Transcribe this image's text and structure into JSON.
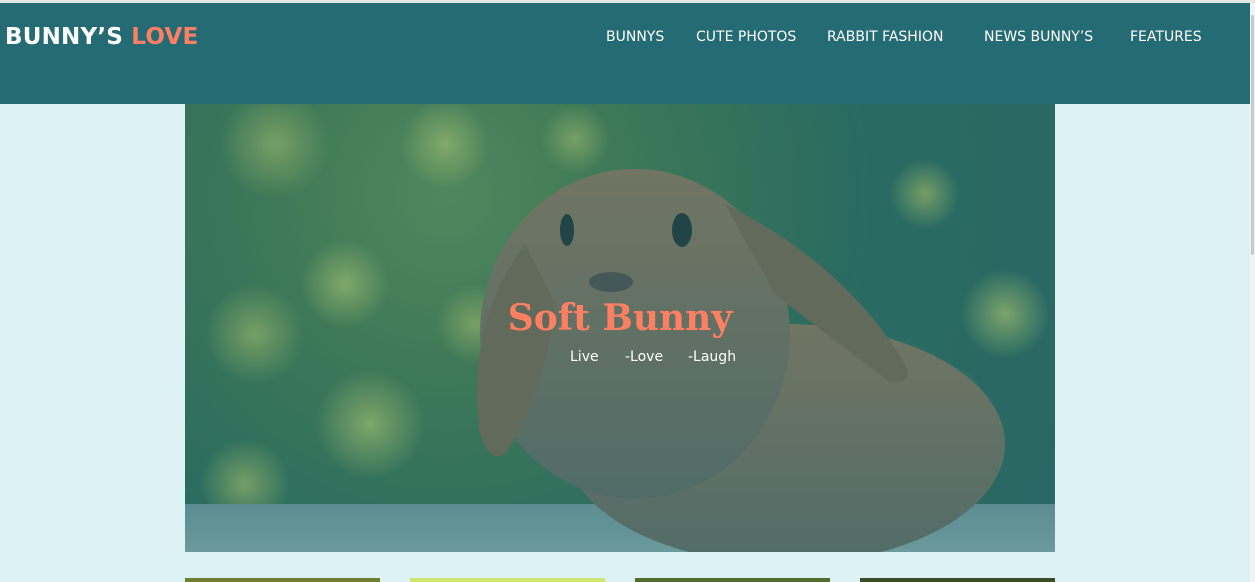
{
  "logo": {
    "part1": "BUNNY’S",
    "part2": "LOVE"
  },
  "nav": {
    "items": [
      "BUNNYS",
      "CUTE PHOTOS",
      "RABBIT FASHION",
      "NEWS BUNNY’S",
      "FEATURES"
    ]
  },
  "hero": {
    "title": "Soft Bunny",
    "subtitle": [
      "Live",
      "-Love",
      "-Laugh"
    ]
  },
  "colors": {
    "header_bg": "#256b74",
    "page_bg": "#dcf2f4",
    "accent": "#ff7f63",
    "text_light": "#ffffff"
  }
}
